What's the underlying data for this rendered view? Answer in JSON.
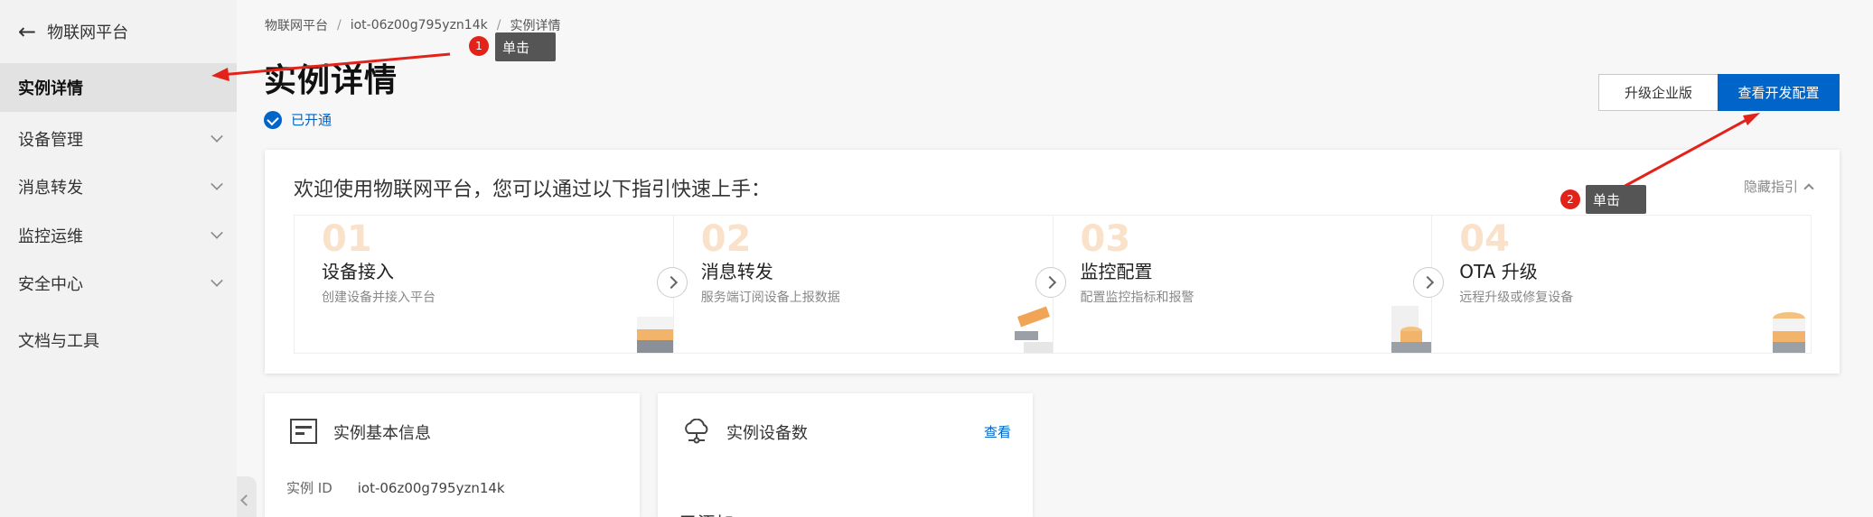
{
  "sidebar": {
    "back_label": "物联网平台",
    "items": [
      {
        "label": "实例详情",
        "active": true,
        "expandable": false
      },
      {
        "label": "设备管理",
        "active": false,
        "expandable": true
      },
      {
        "label": "消息转发",
        "active": false,
        "expandable": true
      },
      {
        "label": "监控运维",
        "active": false,
        "expandable": true
      },
      {
        "label": "安全中心",
        "active": false,
        "expandable": true
      },
      {
        "label": "文档与工具",
        "active": false,
        "expandable": false
      }
    ]
  },
  "breadcrumb": [
    "物联网平台",
    "iot-06z00g795yzn14k",
    "实例详情"
  ],
  "breadcrumb_sep": "/",
  "header": {
    "title": "实例详情",
    "status": "已开通",
    "upgrade_button": "升级企业版",
    "dev_config_button": "查看开发配置"
  },
  "guide": {
    "title": "欢迎使用物联网平台，您可以通过以下指引快速上手：",
    "hide_label": "隐藏指引",
    "steps": [
      {
        "num": "01",
        "name": "设备接入",
        "desc": "创建设备并接入平台"
      },
      {
        "num": "02",
        "name": "消息转发",
        "desc": "服务端订阅设备上报数据"
      },
      {
        "num": "03",
        "name": "监控配置",
        "desc": "配置监控指标和报警"
      },
      {
        "num": "04",
        "name": "OTA 升级",
        "desc": "远程升级或修复设备"
      }
    ]
  },
  "basic_card": {
    "title": "实例基本信息",
    "id_label": "实例 ID",
    "id_value": "iot-06z00g795yzn14k"
  },
  "devices_card": {
    "title": "实例设备数",
    "link": "查看",
    "cut_text": "已添加"
  },
  "annotations": [
    {
      "num": "1",
      "label": "单击"
    },
    {
      "num": "2",
      "label": "单击"
    }
  ],
  "colors": {
    "primary": "#0064c8",
    "annotation_red": "#e2231a",
    "tooltip_bg": "#555555"
  }
}
